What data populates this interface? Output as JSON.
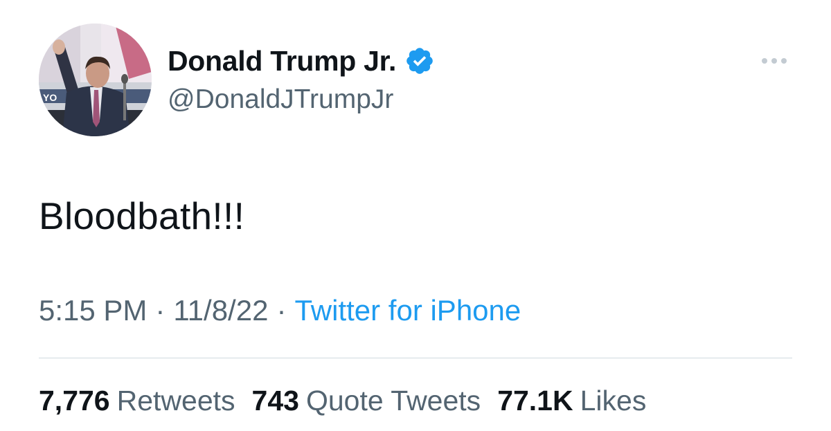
{
  "author": {
    "display_name": "Donald Trump Jr.",
    "handle": "@DonaldJTrumpJr",
    "verified": true,
    "avatar_icon": "profile-photo"
  },
  "tweet": {
    "text": "Bloodbath!!!",
    "time": "5:15 PM",
    "separator": "·",
    "date": "11/8/22",
    "source": "Twitter for iPhone"
  },
  "stats": [
    {
      "count": "7,776",
      "label": "Retweets"
    },
    {
      "count": "743",
      "label": "Quote Tweets"
    },
    {
      "count": "77.1K",
      "label": "Likes"
    }
  ],
  "colors": {
    "accent": "#1d9bf0",
    "text_primary": "#0f1419",
    "text_secondary": "#536471",
    "divider": "#cfd9de"
  },
  "icons": {
    "verified": "verified-badge-icon",
    "more": "more-options-icon"
  }
}
